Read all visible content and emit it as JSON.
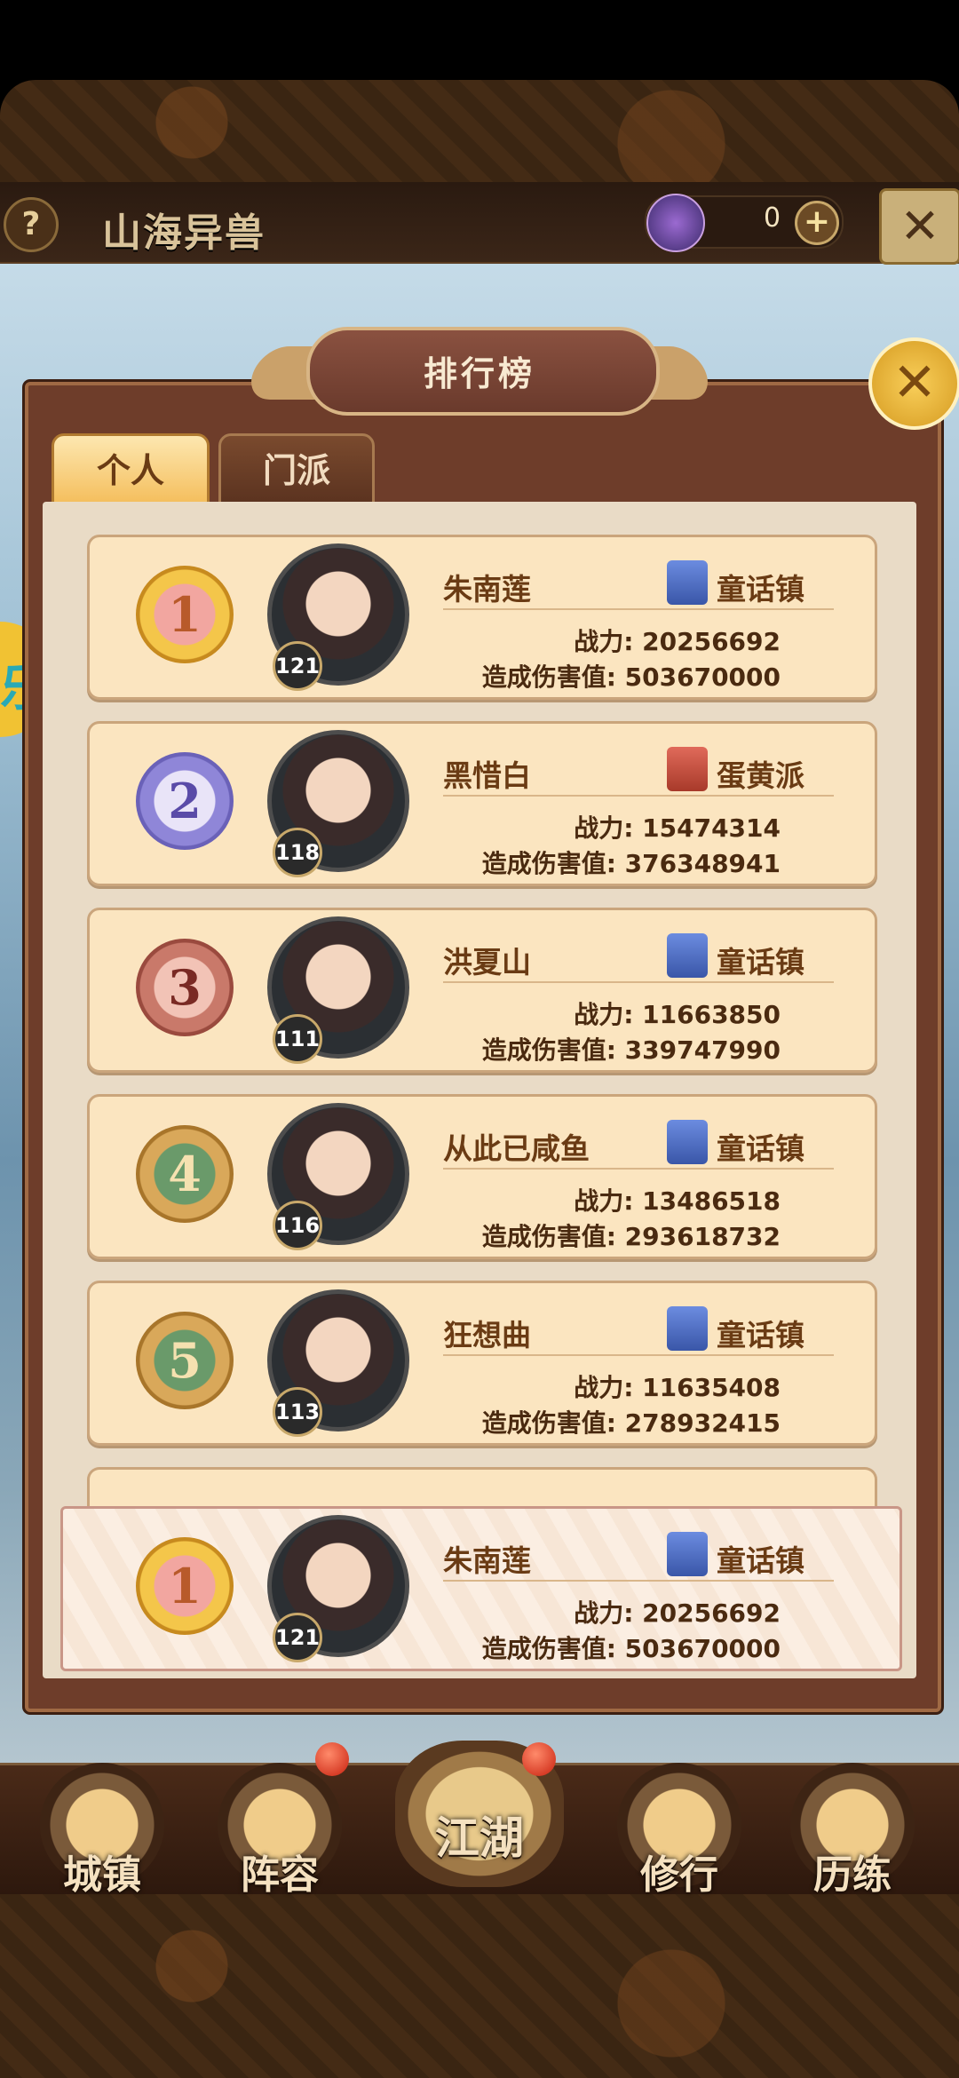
{
  "header": {
    "game_title": "山海异兽",
    "help_symbol": "?",
    "currency_value": "0",
    "add_symbol": "+",
    "close_symbol": "✕"
  },
  "panel": {
    "title": "排行榜",
    "close_symbol": "✕",
    "side_badge_char": "乐"
  },
  "tabs": [
    {
      "label": "个人",
      "active": true
    },
    {
      "label": "门派",
      "active": false
    }
  ],
  "rankings": [
    {
      "rank": "1",
      "name": "朱南莲",
      "level": "121",
      "sect": "童话镇",
      "sect_color": "#3a56a8",
      "power_label": "战力:",
      "power": "20256692",
      "damage_label": "造成伤害值:",
      "damage": "503670000"
    },
    {
      "rank": "2",
      "name": "黑惜白",
      "level": "118",
      "sect": "蛋黄派",
      "sect_color": "#a83a2a",
      "power_label": "战力:",
      "power": "15474314",
      "damage_label": "造成伤害值:",
      "damage": "376348941"
    },
    {
      "rank": "3",
      "name": "洪夏山",
      "level": "111",
      "sect": "童话镇",
      "sect_color": "#3a56a8",
      "power_label": "战力:",
      "power": "11663850",
      "damage_label": "造成伤害值:",
      "damage": "339747990"
    },
    {
      "rank": "4",
      "name": "从此已咸鱼",
      "level": "116",
      "sect": "童话镇",
      "sect_color": "#3a56a8",
      "power_label": "战力:",
      "power": "13486518",
      "damage_label": "造成伤害值:",
      "damage": "293618732"
    },
    {
      "rank": "5",
      "name": "狂想曲",
      "level": "113",
      "sect": "童话镇",
      "sect_color": "#3a56a8",
      "power_label": "战力:",
      "power": "11635408",
      "damage_label": "造成伤害值:",
      "damage": "278932415"
    }
  ],
  "my_rank": {
    "rank": "1",
    "name": "朱南莲",
    "level": "121",
    "sect": "童话镇",
    "power_label": "战力:",
    "power": "20256692",
    "damage_label": "造成伤害值:",
    "damage": "503670000"
  },
  "nav": [
    {
      "label": "城镇",
      "icon": "town-icon"
    },
    {
      "label": "阵容",
      "icon": "lineup-icon"
    },
    {
      "label": "江湖",
      "icon": "jianghu-icon"
    },
    {
      "label": "修行",
      "icon": "cultivation-icon"
    },
    {
      "label": "历练",
      "icon": "training-icon"
    }
  ]
}
